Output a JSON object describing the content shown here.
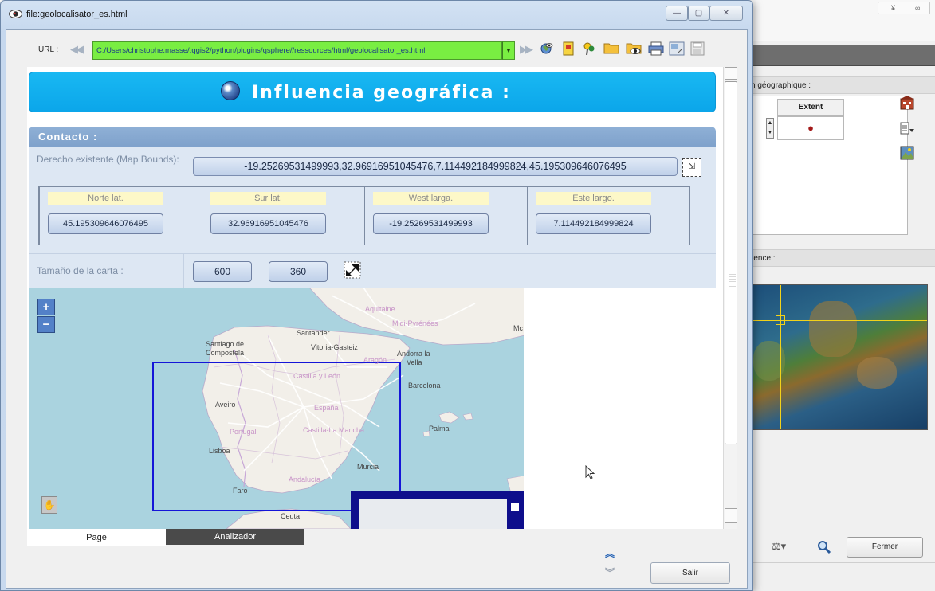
{
  "window": {
    "title": "file:geolocalisator_es.html"
  },
  "urlbar": {
    "label": "URL :",
    "value": "C:/Users/christophe.masse/.qgis2/python/plugins/qsphere//ressources/html/geolocalisator_es.html"
  },
  "toolbar": {
    "icons": [
      "back-icon",
      "forward-icon",
      "world-view-icon",
      "bookmark-icon",
      "pin-icon",
      "folder-icon",
      "folder-view-icon",
      "print-icon",
      "resize-icon",
      "save-icon"
    ]
  },
  "page": {
    "banner_title": "Influencia geográfica :",
    "section_title": "Contacto :",
    "bounds_label": "Derecho existente (Map Bounds):",
    "bounds_value": "-19.25269531499993,32.96916951045476,7.114492184999824,45.195309646076495",
    "coords": [
      {
        "header": "Norte lat.",
        "value": "45.195309646076495"
      },
      {
        "header": "Sur lat.",
        "value": "32.96916951045476"
      },
      {
        "header": "West larga.",
        "value": "-19.25269531499993"
      },
      {
        "header": "Este largo.",
        "value": "7.114492184999824"
      }
    ],
    "size_label": "Tamaño de la carta :",
    "size_width": "600",
    "size_height": "360"
  },
  "map": {
    "zoom_in": "+",
    "zoom_out": "−",
    "labels": {
      "aquitaine": "Aquitaine",
      "midi_pyrenees": "Midi-Pyrénées",
      "santander": "Santander",
      "santiago_1": "Santiago de",
      "santiago_2": "Compostela",
      "vitoria": "Vitoria-Gasteiz",
      "andorra_1": "Andorra la",
      "andorra_2": "Vella",
      "castilla_leon": "Castilla y León",
      "aragon": "Aragón",
      "barcelona": "Barcelona",
      "aveiro": "Aveiro",
      "espana": "España",
      "portugal": "Portugal",
      "castilla_mancha": "Castilla-La Mancha",
      "palma": "Palma",
      "lisboa": "Lisboa",
      "murcia": "Murcia",
      "andalucia": "Andalucía",
      "faro": "Faro",
      "ceuta": "Ceuta",
      "mc": "Mc"
    },
    "colors": {
      "sea": "#aad3df",
      "land": "#f2efe9",
      "bounds_box": "#1515d8",
      "overview_frame": "#0e0e8c"
    }
  },
  "tabs": {
    "page": "Page",
    "analyzer": "Analizador"
  },
  "footer": {
    "exit": "Salir"
  },
  "background_window": {
    "strip1": "n géographique :",
    "extent_header": "Extent",
    "strip2": "rence :",
    "close_button": "Fermer",
    "top_controls": [
      "¥",
      "∞"
    ]
  }
}
